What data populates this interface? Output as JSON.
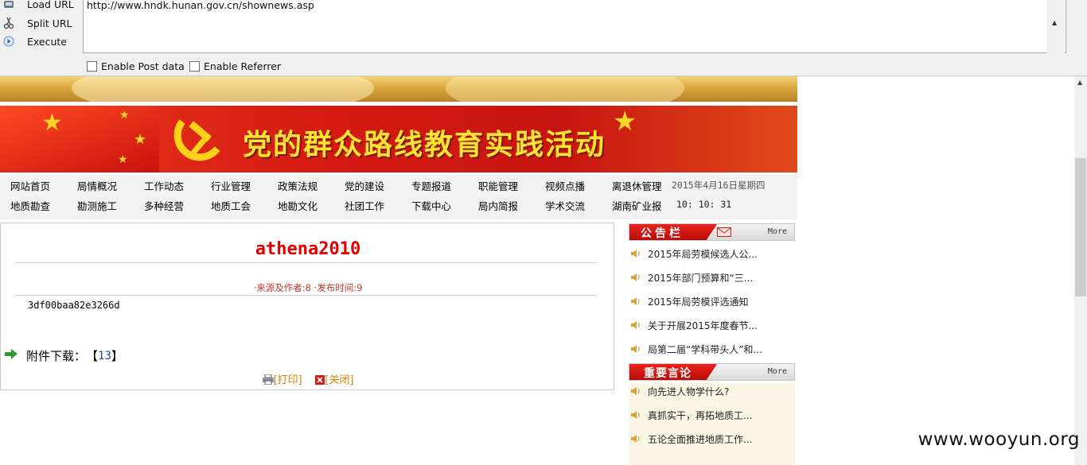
{
  "toolbar": {
    "load_url": "Load URL",
    "split_url": "Split URL",
    "execute": "Execute",
    "url_value": "http://www.hndk.hunan.gov.cn/shownews.asp",
    "enable_post": "Enable Post data",
    "enable_referrer": "Enable Referrer"
  },
  "banner": {
    "title": "党的群众路线教育实践活动"
  },
  "nav": {
    "row1": [
      "网站首页",
      "局情概况",
      "工作动态",
      "行业管理",
      "政策法规",
      "党的建设",
      "专题报道",
      "职能管理",
      "视频点播",
      "离退休管理"
    ],
    "row2": [
      "地质勘查",
      "勘测施工",
      "多种经营",
      "地质工会",
      "地勘文化",
      "社团工作",
      "下载中心",
      "局内简报",
      "学术交流",
      "湖南矿业报"
    ],
    "date": "2015年4月16日星期四",
    "time": "10: 10: 31"
  },
  "article": {
    "title": "athena2010",
    "meta": "·来源及作者:8  ·发布时间:9",
    "body": "3df00baa82e3266d",
    "attach_label": "附件下载：",
    "attach_open": "【",
    "attach_link": "13",
    "attach_close": "】",
    "print": "[打印]",
    "close": "[关闭]"
  },
  "notice": {
    "heading": "公告栏",
    "more": "More",
    "items": [
      "2015年局劳模候选人公...",
      "2015年部门预算和“三...",
      "2015年局劳模评选通知",
      "关于开展2015年度春节...",
      "局第二届“学科带头人”和..."
    ]
  },
  "speech": {
    "heading": "重要言论",
    "more": "More",
    "items": [
      "向先进人物学什么?",
      "真抓实干，再拓地质工...",
      "五论全面推进地质工作..."
    ]
  },
  "watermark": "www.wooyun.org",
  "colors": {
    "accent_red": "#d51b12",
    "title_red": "#e10000",
    "link_blue": "#1a3fb0",
    "action_orange": "#e07b00"
  }
}
